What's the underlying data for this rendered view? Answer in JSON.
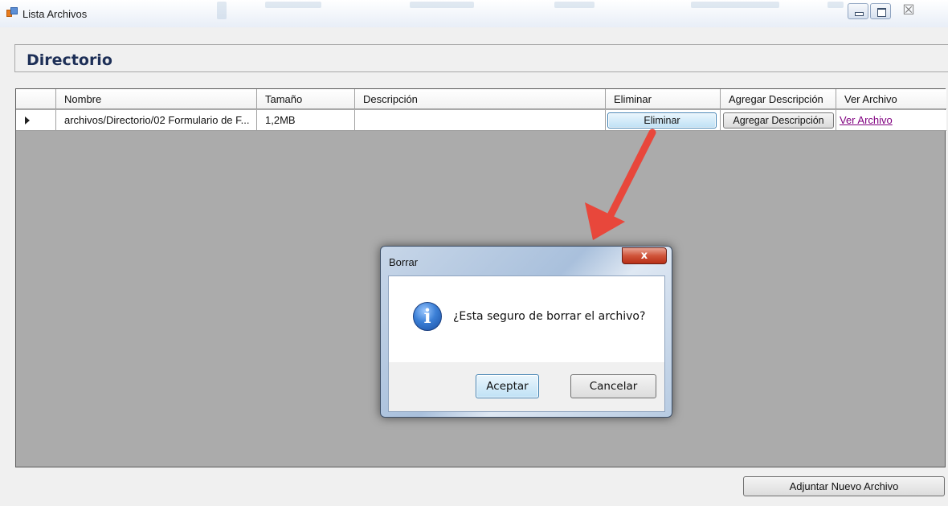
{
  "window": {
    "title": "Lista Archivos",
    "close_glyph": "☒"
  },
  "header": {
    "title": "Directorio"
  },
  "grid": {
    "columns": [
      "Nombre",
      "Tamaño",
      "Descripción",
      "Eliminar",
      "Agregar Descripción",
      "Ver Archivo"
    ],
    "rows": [
      {
        "nombre": "archivos/Directorio/02 Formulario de F...",
        "tamano": "1,2MB",
        "descripcion": "",
        "eliminar_label": "Eliminar",
        "agregar_label": "Agregar Descripción",
        "ver_label": "Ver Archivo"
      }
    ]
  },
  "dialog": {
    "title": "Borrar",
    "close_glyph": "x",
    "icon_glyph": "i",
    "message": "¿Esta seguro de borrar el archivo?",
    "ok_label": "Aceptar",
    "cancel_label": "Cancelar"
  },
  "footer": {
    "attach_label": "Adjuntar Nuevo Archivo"
  },
  "colors": {
    "header_title": "#1d2f57",
    "grid_bg": "#ababab",
    "link": "#800080",
    "arrow": "#e8473b"
  }
}
